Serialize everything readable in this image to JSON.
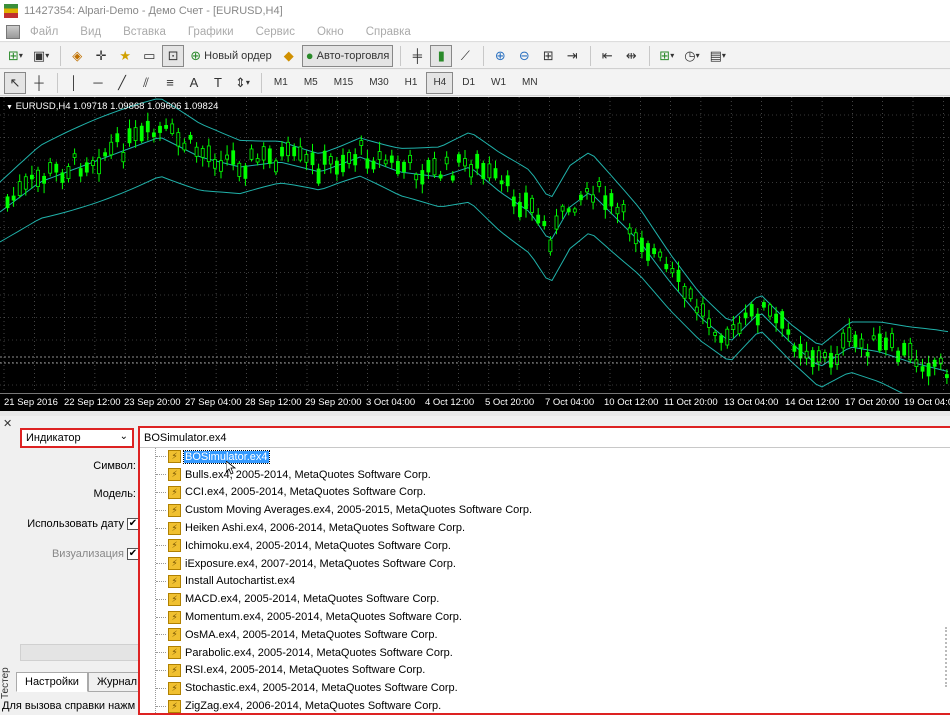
{
  "window": {
    "title": "11427354: Alpari-Demo - Демо Счет - [EURUSD,H4]"
  },
  "menu": [
    "Файл",
    "Вид",
    "Вставка",
    "Графики",
    "Сервис",
    "Окно",
    "Справка"
  ],
  "toolbar": {
    "new_order_label": "Новый ордер",
    "auto_trading_label": "Авто-торговля",
    "timeframes": [
      "M1",
      "M5",
      "M15",
      "M30",
      "H1",
      "H4",
      "D1",
      "W1",
      "MN"
    ],
    "active_timeframe": "H4"
  },
  "chart": {
    "header": "EURUSD,H4  1.09718 1.09868 1.09606 1.09824",
    "time_labels": [
      "21 Sep 2016",
      "22 Sep 12:00",
      "23 Sep 20:00",
      "27 Sep 04:00",
      "28 Sep 12:00",
      "29 Sep 20:00",
      "3 Oct 04:00",
      "4 Oct 12:00",
      "5 Oct 20:00",
      "7 Oct 04:00",
      "10 Oct 12:00",
      "11 Oct 20:00",
      "13 Oct 04:00",
      "14 Oct 12:00",
      "17 Oct 20:00",
      "19 Oct 04:00"
    ],
    "colors": {
      "background": "#000000",
      "candle": "#00ff00",
      "bands": "#20b2aa",
      "grid": "#cfcfcf"
    }
  },
  "tester": {
    "side_tab": "Тестер",
    "type_select": "Индикатор",
    "labels": {
      "symbol": "Символ:",
      "model": "Модель:",
      "use_date": "Использовать дату",
      "visualization": "Визуализация"
    },
    "tabs": [
      "Настройки",
      "Журнал"
    ],
    "status_text": "Для вызова справки нажм",
    "expert_combo": {
      "value": "BOSimulator.ex4",
      "items": [
        "BOSimulator.ex4",
        "Bulls.ex4, 2005-2014, MetaQuotes Software Corp.",
        "CCI.ex4, 2005-2014, MetaQuotes Software Corp.",
        "Custom Moving Averages.ex4, 2005-2015, MetaQuotes Software Corp.",
        "Heiken Ashi.ex4, 2006-2014, MetaQuotes Software Corp.",
        "Ichimoku.ex4, 2005-2014, MetaQuotes Software Corp.",
        "iExposure.ex4, 2007-2014, MetaQuotes Software Corp.",
        "Install Autochartist.ex4",
        "MACD.ex4, 2005-2014, MetaQuotes Software Corp.",
        "Momentum.ex4, 2005-2014, MetaQuotes Software Corp.",
        "OsMA.ex4, 2005-2014, MetaQuotes Software Corp.",
        "Parabolic.ex4, 2005-2014, MetaQuotes Software Corp.",
        "RSI.ex4, 2005-2014, MetaQuotes Software Corp.",
        "Stochastic.ex4, 2005-2014, MetaQuotes Software Corp.",
        "ZigZag.ex4, 2006-2014, MetaQuotes Software Corp."
      ],
      "selected": "BOSimulator.ex4"
    }
  }
}
